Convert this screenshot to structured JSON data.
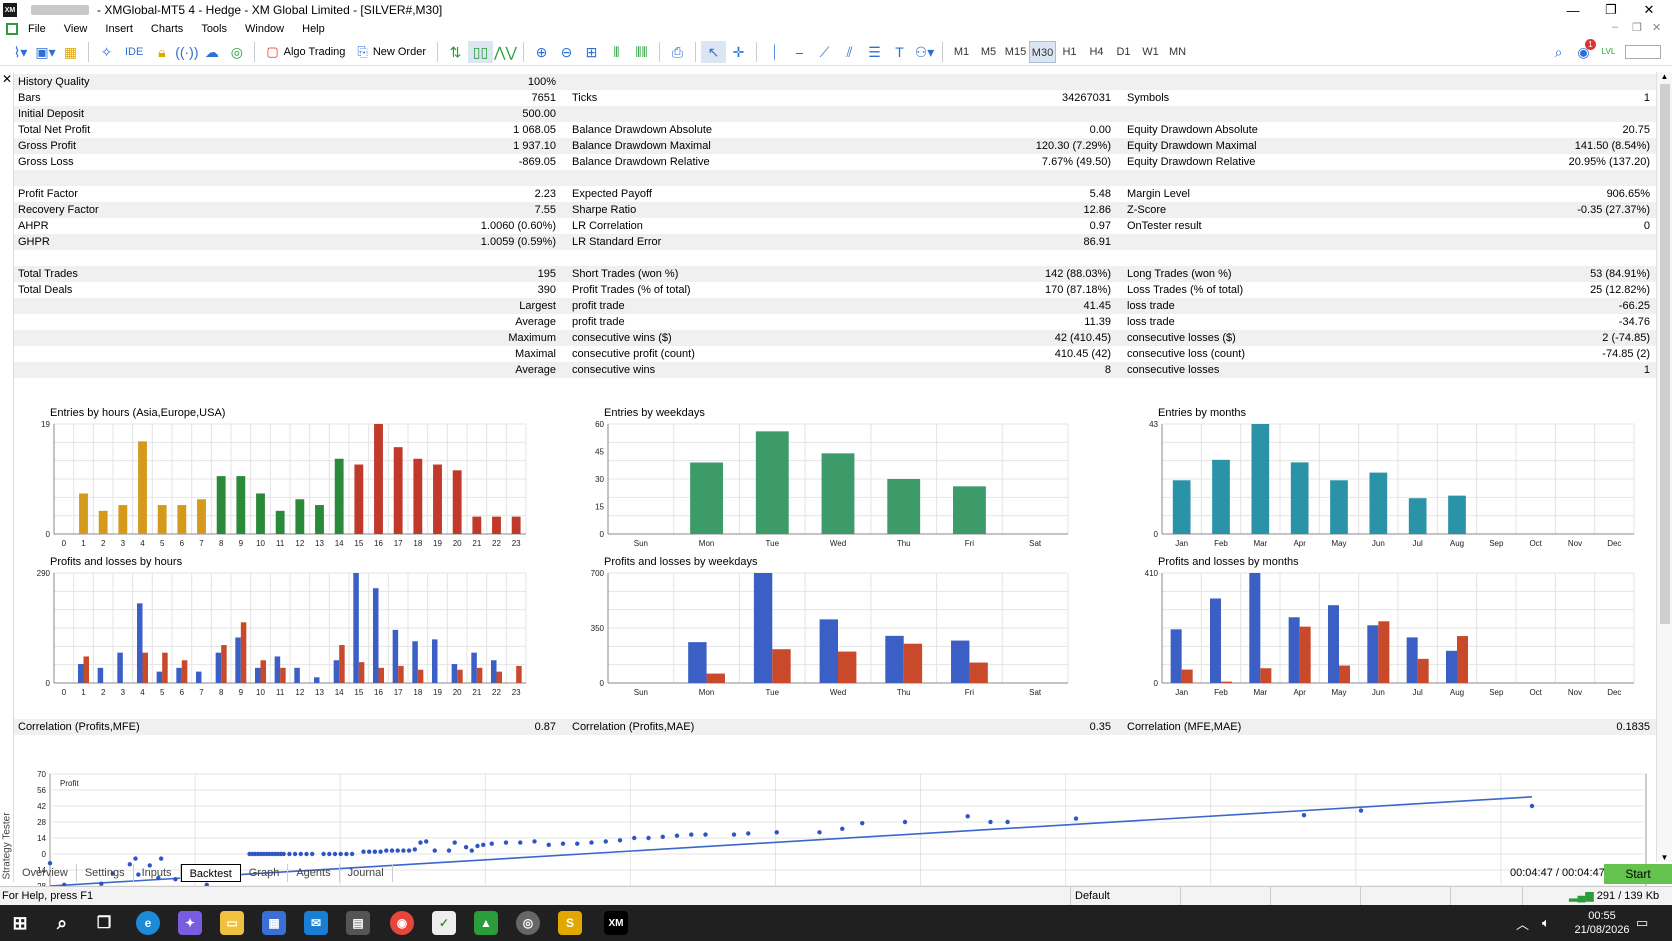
{
  "titlebar": {
    "app_icon": "XM",
    "title": "- XMGlobal-MT5 4 - Hedge - XM Global Limited - [SILVER#,M30]",
    "minimize": "—",
    "restore": "❐",
    "close": "✕"
  },
  "menu": {
    "items": [
      "File",
      "View",
      "Insert",
      "Charts",
      "Tools",
      "Window",
      "Help"
    ]
  },
  "toolbar": {
    "algo_trading": "Algo Trading",
    "new_order": "New Order",
    "ide": "IDE",
    "timeframes": [
      "M1",
      "M5",
      "M15",
      "M30",
      "H1",
      "H4",
      "D1",
      "W1",
      "MN"
    ],
    "selected_timeframe": "M30",
    "notification_count": "1",
    "ivl": "LVL"
  },
  "colors": {
    "accent": "#2e6fd6",
    "progress_green": "#6fd04b",
    "start_green": "#66c24f"
  },
  "report": {
    "history_quality": {
      "label": "History Quality",
      "value": "100%"
    },
    "bars": {
      "label": "Bars",
      "value": "7651"
    },
    "ticks": {
      "label": "Ticks",
      "value": "34267031"
    },
    "symbols": {
      "label": "Symbols",
      "value": "1"
    },
    "initial_deposit": {
      "label": "Initial Deposit",
      "value": "500.00"
    },
    "total_net_profit": {
      "label": "Total Net Profit",
      "value": "1 068.05"
    },
    "bal_dd_abs": {
      "label": "Balance Drawdown Absolute",
      "value": "0.00"
    },
    "eq_dd_abs": {
      "label": "Equity Drawdown Absolute",
      "value": "20.75"
    },
    "gross_profit": {
      "label": "Gross Profit",
      "value": "1 937.10"
    },
    "bal_dd_max": {
      "label": "Balance Drawdown Maximal",
      "value": "120.30 (7.29%)"
    },
    "eq_dd_max": {
      "label": "Equity Drawdown Maximal",
      "value": "141.50 (8.54%)"
    },
    "gross_loss": {
      "label": "Gross Loss",
      "value": "-869.05"
    },
    "bal_dd_rel": {
      "label": "Balance Drawdown Relative",
      "value": "7.67% (49.50)"
    },
    "eq_dd_rel": {
      "label": "Equity Drawdown Relative",
      "value": "20.95% (137.20)"
    },
    "profit_factor": {
      "label": "Profit Factor",
      "value": "2.23"
    },
    "expected_payoff": {
      "label": "Expected Payoff",
      "value": "5.48"
    },
    "margin_level": {
      "label": "Margin Level",
      "value": "906.65%"
    },
    "recovery_factor": {
      "label": "Recovery Factor",
      "value": "7.55"
    },
    "sharpe_ratio": {
      "label": "Sharpe Ratio",
      "value": "12.86"
    },
    "z_score": {
      "label": "Z-Score",
      "value": "-0.35 (27.37%)"
    },
    "ahpr": {
      "label": "AHPR",
      "value": "1.0060 (0.60%)"
    },
    "lr_correlation": {
      "label": "LR Correlation",
      "value": "0.97"
    },
    "ontester": {
      "label": "OnTester result",
      "value": "0"
    },
    "ghpr": {
      "label": "GHPR",
      "value": "1.0059 (0.59%)"
    },
    "lr_std_error": {
      "label": "LR Standard Error",
      "value": "86.91"
    },
    "total_trades": {
      "label": "Total Trades",
      "value": "195"
    },
    "short_trades": {
      "label": "Short Trades (won %)",
      "value": "142 (88.03%)"
    },
    "long_trades": {
      "label": "Long Trades (won %)",
      "value": "53 (84.91%)"
    },
    "total_deals": {
      "label": "Total Deals",
      "value": "390"
    },
    "profit_trades": {
      "label": "Profit Trades (% of total)",
      "value": "170 (87.18%)"
    },
    "loss_trades": {
      "label": "Loss Trades (% of total)",
      "value": "25 (12.82%)"
    },
    "largest": {
      "prefix": "Largest",
      "profit_label": "profit trade",
      "profit_value": "41.45",
      "loss_label": "loss trade",
      "loss_value": "-66.25"
    },
    "average": {
      "prefix": "Average",
      "profit_label": "profit trade",
      "profit_value": "11.39",
      "loss_label": "loss trade",
      "loss_value": "-34.76"
    },
    "maximum": {
      "prefix": "Maximum",
      "profit_label": "consecutive wins ($)",
      "profit_value": "42 (410.45)",
      "loss_label": "consecutive losses ($)",
      "loss_value": "2 (-74.85)"
    },
    "maximal": {
      "prefix": "Maximal",
      "profit_label": "consecutive profit (count)",
      "profit_value": "410.45 (42)",
      "loss_label": "consecutive loss (count)",
      "loss_value": "-74.85 (2)"
    },
    "average2": {
      "prefix": "Average",
      "profit_label": "consecutive wins",
      "profit_value": "8",
      "loss_label": "consecutive losses",
      "loss_value": "1"
    },
    "corr_profits_mfe": {
      "label": "Correlation (Profits,MFE)",
      "value": "0.87"
    },
    "corr_profits_mae": {
      "label": "Correlation (Profits,MAE)",
      "value": "0.35"
    },
    "corr_mfe_mae": {
      "label": "Correlation (MFE,MAE)",
      "value": "0.1835"
    }
  },
  "chart_data": [
    {
      "type": "bar",
      "title": "Entries by hours (Asia,Europe,USA)",
      "categories": [
        "0",
        "1",
        "2",
        "3",
        "4",
        "5",
        "6",
        "7",
        "8",
        "9",
        "10",
        "11",
        "12",
        "13",
        "14",
        "15",
        "16",
        "17",
        "18",
        "19",
        "20",
        "21",
        "22",
        "23"
      ],
      "values": [
        0,
        7,
        4,
        5,
        16,
        5,
        5,
        6,
        10,
        10,
        7,
        4,
        6,
        5,
        13,
        12,
        19,
        15,
        13,
        12,
        11,
        3,
        3,
        3
      ],
      "ylim": [
        0,
        19
      ],
      "yticks": [
        "19",
        "0"
      ]
    },
    {
      "type": "bar",
      "title": "Entries by weekdays",
      "categories": [
        "Sun",
        "Mon",
        "Tue",
        "Wed",
        "Thu",
        "Fri",
        "Sat"
      ],
      "values": [
        0,
        39,
        56,
        44,
        30,
        26,
        0
      ],
      "ylim": [
        0,
        60
      ],
      "yticks": [
        "60",
        "45",
        "30",
        "15",
        "0"
      ]
    },
    {
      "type": "bar",
      "title": "Entries by months",
      "categories": [
        "Jan",
        "Feb",
        "Mar",
        "Apr",
        "May",
        "Jun",
        "Jul",
        "Aug",
        "Sep",
        "Oct",
        "Nov",
        "Dec"
      ],
      "values": [
        21,
        29,
        43,
        28,
        21,
        24,
        14,
        15,
        0,
        0,
        0,
        0
      ],
      "ylim": [
        0,
        43
      ],
      "yticks": [
        "43",
        "0"
      ]
    },
    {
      "type": "bar",
      "title": "Profits and losses by hours",
      "categories": [
        "0",
        "1",
        "2",
        "3",
        "4",
        "5",
        "6",
        "7",
        "8",
        "9",
        "10",
        "11",
        "12",
        "13",
        "14",
        "15",
        "16",
        "17",
        "18",
        "19",
        "20",
        "21",
        "22",
        "23"
      ],
      "series": [
        {
          "values": [
            0,
            50,
            40,
            80,
            210,
            30,
            40,
            30,
            80,
            120,
            40,
            70,
            40,
            15,
            60,
            290,
            250,
            140,
            110,
            115,
            50,
            80,
            60,
            0
          ]
        },
        {
          "values": [
            0,
            70,
            0,
            0,
            80,
            80,
            60,
            0,
            100,
            160,
            60,
            40,
            0,
            0,
            100,
            55,
            40,
            45,
            35,
            0,
            35,
            40,
            30,
            45
          ]
        }
      ],
      "ylim": [
        0,
        290
      ],
      "yticks": [
        "290",
        "0"
      ]
    },
    {
      "type": "bar",
      "title": "Profits and losses by weekdays",
      "categories": [
        "Sun",
        "Mon",
        "Tue",
        "Wed",
        "Thu",
        "Fri",
        "Sat"
      ],
      "series": [
        {
          "values": [
            0,
            260,
            700,
            405,
            300,
            270,
            0
          ]
        },
        {
          "values": [
            0,
            60,
            215,
            200,
            250,
            130,
            0
          ]
        }
      ],
      "ylim": [
        0,
        700
      ],
      "yticks": [
        "700",
        "350",
        "0"
      ]
    },
    {
      "type": "bar",
      "title": "Profits and losses by months",
      "categories": [
        "Jan",
        "Feb",
        "Mar",
        "Apr",
        "May",
        "Jun",
        "Jul",
        "Aug",
        "Sep",
        "Oct",
        "Nov",
        "Dec"
      ],
      "series": [
        {
          "values": [
            200,
            315,
            410,
            245,
            290,
            215,
            170,
            120,
            0,
            0,
            0,
            0
          ]
        },
        {
          "values": [
            50,
            5,
            55,
            210,
            65,
            230,
            90,
            175,
            0,
            0,
            0,
            0
          ]
        }
      ],
      "ylim": [
        0,
        410
      ],
      "yticks": [
        "410",
        "0"
      ]
    },
    {
      "type": "scatter",
      "title": "",
      "legend": "Profit",
      "ylim": [
        -28,
        70
      ],
      "yticks": [
        "70",
        "56",
        "42",
        "28",
        "14",
        "0",
        "-14",
        "-28"
      ],
      "points": [
        [
          0,
          -8
        ],
        [
          5,
          -27
        ],
        [
          18,
          -26
        ],
        [
          22,
          -17
        ],
        [
          28,
          -9
        ],
        [
          30,
          -4
        ],
        [
          31,
          -18
        ],
        [
          35,
          -10
        ],
        [
          38,
          -21
        ],
        [
          39,
          -4
        ],
        [
          44,
          -22
        ],
        [
          55,
          -27
        ],
        [
          70,
          0
        ],
        [
          71,
          0
        ],
        [
          72,
          0
        ],
        [
          73,
          0
        ],
        [
          74,
          0
        ],
        [
          75,
          0
        ],
        [
          76,
          0
        ],
        [
          77,
          0
        ],
        [
          78,
          0
        ],
        [
          79,
          0
        ],
        [
          80,
          0
        ],
        [
          81,
          0
        ],
        [
          82,
          0
        ],
        [
          84,
          0
        ],
        [
          86,
          0
        ],
        [
          88,
          0
        ],
        [
          90,
          0
        ],
        [
          92,
          0
        ],
        [
          96,
          0
        ],
        [
          98,
          0
        ],
        [
          100,
          0
        ],
        [
          102,
          0
        ],
        [
          104,
          0
        ],
        [
          106,
          0
        ],
        [
          110,
          2
        ],
        [
          112,
          2
        ],
        [
          114,
          2
        ],
        [
          116,
          2
        ],
        [
          118,
          3
        ],
        [
          120,
          3
        ],
        [
          122,
          3
        ],
        [
          124,
          3
        ],
        [
          126,
          3
        ],
        [
          128,
          4
        ],
        [
          130,
          10
        ],
        [
          132,
          11
        ],
        [
          135,
          3
        ],
        [
          140,
          3
        ],
        [
          142,
          10
        ],
        [
          146,
          6
        ],
        [
          148,
          3
        ],
        [
          150,
          7
        ],
        [
          152,
          8
        ],
        [
          155,
          9
        ],
        [
          160,
          10
        ],
        [
          165,
          10
        ],
        [
          170,
          11
        ],
        [
          175,
          8
        ],
        [
          180,
          9
        ],
        [
          185,
          9
        ],
        [
          190,
          10
        ],
        [
          195,
          11
        ],
        [
          200,
          12
        ],
        [
          205,
          14
        ],
        [
          210,
          14
        ],
        [
          215,
          15
        ],
        [
          220,
          16
        ],
        [
          225,
          17
        ],
        [
          230,
          17
        ],
        [
          240,
          17
        ],
        [
          245,
          18
        ],
        [
          255,
          19
        ],
        [
          270,
          19
        ],
        [
          278,
          22
        ],
        [
          285,
          27
        ],
        [
          300,
          28
        ],
        [
          322,
          33
        ],
        [
          330,
          28
        ],
        [
          336,
          28
        ],
        [
          360,
          31
        ],
        [
          440,
          34
        ],
        [
          460,
          38
        ],
        [
          520,
          42
        ]
      ],
      "trend": [
        [
          0,
          -28
        ],
        [
          520,
          50
        ]
      ]
    }
  ],
  "bottom_tabs": [
    "Overview",
    "Settings",
    "Inputs",
    "Backtest",
    "Graph",
    "Agents",
    "Journal"
  ],
  "active_tab": "Backtest",
  "sidebar_label": "Strategy Tester",
  "timer": "00:04:47 / 00:04:47",
  "start_label": "Start",
  "status": {
    "help": "For Help, press F1",
    "profile": "Default",
    "traffic": "291 / 139 Kb"
  },
  "taskbar": {
    "time": "00:55",
    "date": "21/08/2026",
    "xm": "XM"
  }
}
